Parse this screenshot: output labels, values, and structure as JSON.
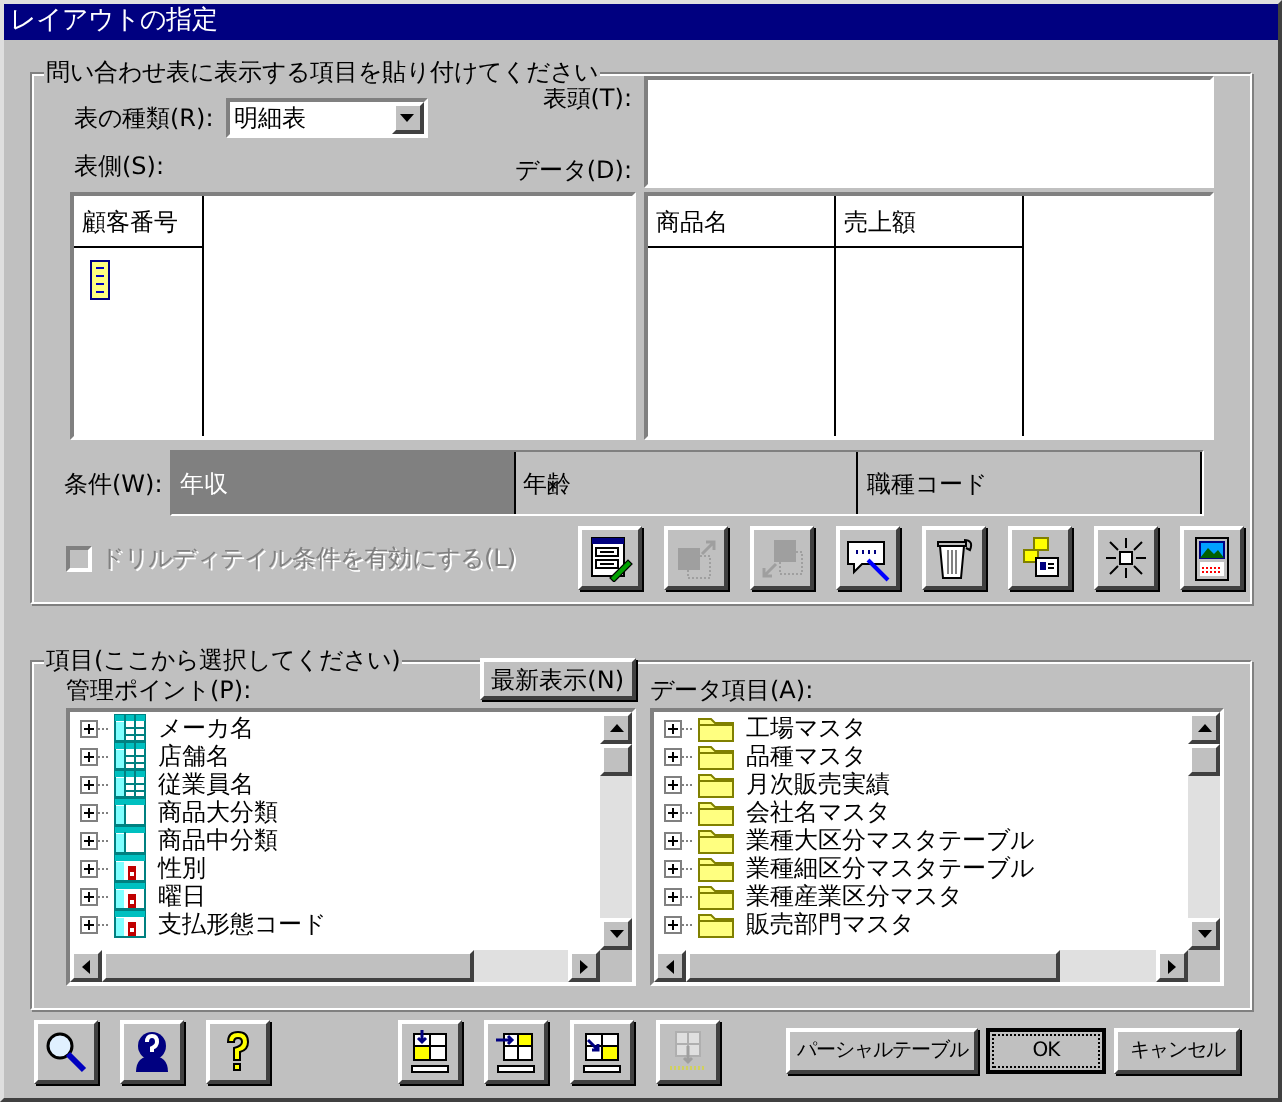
{
  "window": {
    "title": "レイアウトの指定"
  },
  "layout_panel": {
    "title": "問い合わせ表に表示する項目を貼り付けてください",
    "table_type": {
      "label": "表の種類(R):",
      "value": "明細表"
    },
    "column_head": {
      "label": "表頭(T):"
    },
    "row_side": {
      "label": "表側(S):",
      "columns": [
        "顧客番号"
      ]
    },
    "data": {
      "label": "データ(D):",
      "columns": [
        "商品名",
        "売上額"
      ]
    },
    "conditions": {
      "label": "条件(W):",
      "items": [
        {
          "text": "年収",
          "selected": true
        },
        {
          "text": "年齢",
          "selected": false
        },
        {
          "text": "職種コード",
          "selected": false
        }
      ]
    },
    "drill_detail": {
      "label": "ドリルディテイル条件を有効にする(L)",
      "checked": false,
      "disabled": true
    },
    "tools": [
      {
        "kind": "and-or",
        "disabled": false
      },
      {
        "kind": "copy-up",
        "disabled": true
      },
      {
        "kind": "copy-down",
        "disabled": true
      },
      {
        "kind": "query",
        "disabled": false
      },
      {
        "kind": "trash",
        "disabled": false
      },
      {
        "kind": "layout",
        "disabled": false
      },
      {
        "kind": "burst",
        "disabled": false
      },
      {
        "kind": "calendar",
        "disabled": false
      }
    ]
  },
  "items_panel": {
    "title": "項目(ここから選択してください)",
    "refresh_button": "最新表示(N)",
    "management_points": {
      "label": "管理ポイント(P):",
      "items": [
        {
          "text": "メーカ名",
          "kind": "grid"
        },
        {
          "text": "店舗名",
          "kind": "grid"
        },
        {
          "text": "従業員名",
          "kind": "grid"
        },
        {
          "text": "商品大分類",
          "kind": "header"
        },
        {
          "text": "商品中分類",
          "kind": "header"
        },
        {
          "text": "性別",
          "kind": "marked"
        },
        {
          "text": "曜日",
          "kind": "marked"
        },
        {
          "text": "支払形態コード",
          "kind": "marked"
        }
      ]
    },
    "data_items": {
      "label": "データ項目(A):",
      "items": [
        {
          "text": "工場マスタ"
        },
        {
          "text": "品種マスタ"
        },
        {
          "text": "月次販売実績"
        },
        {
          "text": "会社名マスタ"
        },
        {
          "text": "業種大区分マスタテーブル"
        },
        {
          "text": "業種細区分マスタテーブル"
        },
        {
          "text": "業種産業区分マスタ"
        },
        {
          "text": "販売部門マスタ"
        }
      ]
    }
  },
  "footer": {
    "tools": [
      {
        "kind": "search",
        "disabled": false
      },
      {
        "kind": "help",
        "disabled": false
      },
      {
        "kind": "question",
        "disabled": false
      }
    ],
    "insert_tools": [
      {
        "kind": "insert-top",
        "disabled": false
      },
      {
        "kind": "insert-left",
        "disabled": false
      },
      {
        "kind": "insert-right",
        "disabled": false
      },
      {
        "kind": "insert-below",
        "disabled": true
      }
    ],
    "buttons": [
      {
        "label": "パーシャルテーブル",
        "default": false
      },
      {
        "label": "OK",
        "default": true
      },
      {
        "label": "キャンセル",
        "default": false
      }
    ]
  }
}
